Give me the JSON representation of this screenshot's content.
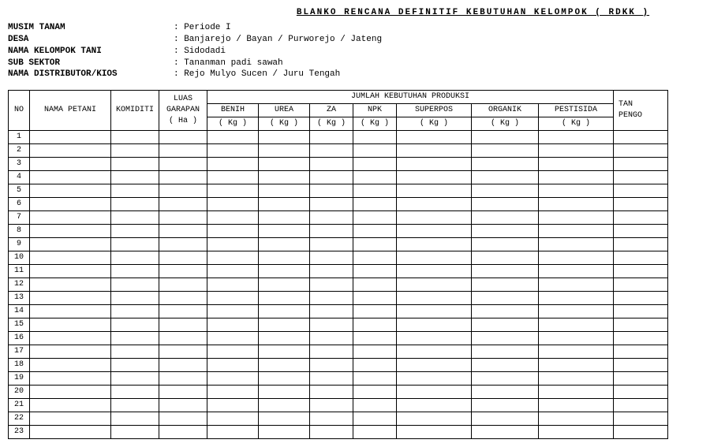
{
  "title": "BLANKO RENCANA DEFINITIF KEBUTUHAN KELOMPOK ( RDKK )",
  "info": {
    "musim_label": "MUSIM TANAM",
    "musim_value": ": Periode I",
    "desa_label": "DESA",
    "desa_value": ": Banjarejo / Bayan / Purworejo / Jateng",
    "kel_label": "NAMA KELOMPOK TANI",
    "kel_value": ": Sidodadi",
    "sub_label": "SUB SEKTOR",
    "sub_value": ": Tananman padi sawah",
    "dist_label": "NAMA DISTRIBUTOR/KIOS",
    "dist_value": ": Rejo Mulyo Sucen / Juru Tengah"
  },
  "headers": {
    "no": "NO",
    "petani": "NAMA PETANI",
    "komoditi": "KOMIDITI",
    "luas1": "LUAS",
    "luas2": "GARAPAN",
    "luas3": "( Ha )",
    "group": "JUMLAH KEBUTUHAN PRODUKSI",
    "benih1": "BENIH",
    "benih2": "( Kg )",
    "urea1": "UREA",
    "urea2": "( Kg )",
    "za1": "ZA",
    "za2": "( Kg )",
    "npk1": "NPK",
    "npk2": "( Kg )",
    "super1": "SUPERPOS",
    "super2": "( Kg )",
    "org1": "ORGANIK",
    "org2": "( Kg )",
    "pest1": "PESTISIDA",
    "pest2": "( Kg )",
    "tan1": "TAN",
    "tan2": "PENGO"
  },
  "rows": [
    {
      "no": "1"
    },
    {
      "no": "2"
    },
    {
      "no": "3"
    },
    {
      "no": "4"
    },
    {
      "no": "5"
    },
    {
      "no": "6"
    },
    {
      "no": "7"
    },
    {
      "no": "8"
    },
    {
      "no": "9"
    },
    {
      "no": "10"
    },
    {
      "no": "11"
    },
    {
      "no": "12"
    },
    {
      "no": "13"
    },
    {
      "no": "14"
    },
    {
      "no": "15"
    },
    {
      "no": "16"
    },
    {
      "no": "17"
    },
    {
      "no": "18"
    },
    {
      "no": "19"
    },
    {
      "no": "20"
    },
    {
      "no": "21"
    },
    {
      "no": "22"
    },
    {
      "no": "23"
    }
  ]
}
